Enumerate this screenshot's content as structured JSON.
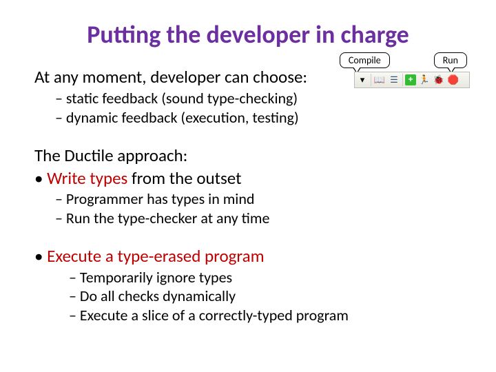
{
  "title": "Putting the developer in charge",
  "callouts": {
    "compile": "Compile",
    "run": "Run"
  },
  "line1": "At any moment, developer can choose:",
  "sub1a": "– static feedback (sound type-checking)",
  "sub1b": "– dynamic feedback (execution, testing)",
  "ductile_intro": "The Ductile approach:",
  "bullet1_prefix": "• ",
  "bullet1_red": "Write types",
  "bullet1_rest": " from the outset",
  "sub2a": "– Programmer has types in mind",
  "sub2b": "– Run the type-checker at any time",
  "bullet2_prefix": "• ",
  "bullet2_red": "Execute a type-erased program",
  "sub3a": "– Temporarily ignore types",
  "sub3b": "– Do all checks dynamically",
  "sub3c": "– Execute a slice of a correctly-typed program"
}
